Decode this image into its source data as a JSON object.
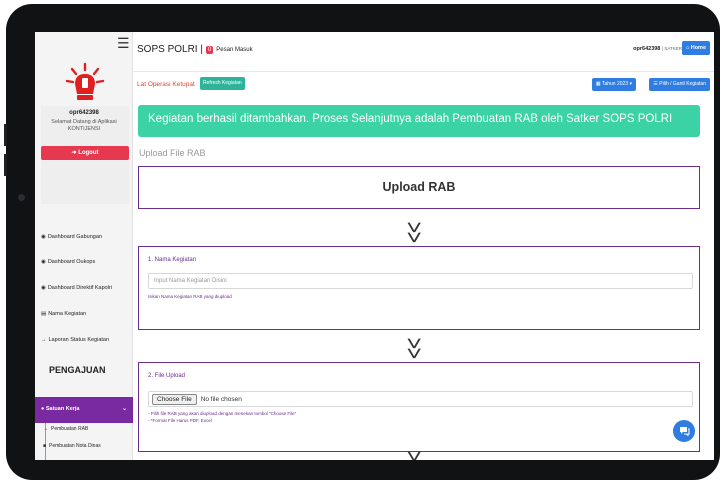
{
  "topbar": {
    "brand": "SOPS POLRI |",
    "pesan_count": "0",
    "pesan_label": "Pesan Masuk",
    "user": "opr642398",
    "user_role": "| SATKER",
    "home_label": "Home"
  },
  "sidebar": {
    "user_id": "opr642398",
    "welcome_line1": "Selamat Datang di Aplikasi",
    "welcome_line2": "KONTIJENSI",
    "logout_label": "Logout",
    "items": [
      {
        "label": "Dashboard Gabungan",
        "icon": "dashboard-icon"
      },
      {
        "label": "Dashboard Oukops",
        "icon": "dashboard-icon"
      },
      {
        "label": "Dashboard Direktif Kapolri",
        "icon": "dashboard-icon"
      },
      {
        "label": "Nama Kegiatan",
        "icon": "list-icon"
      },
      {
        "label": "Laporan Status Kegiatan",
        "icon": "arrow-right-icon"
      }
    ],
    "section_label": "PENGAJUAN",
    "satker_label": "Satuan Kerja",
    "sub_items": [
      {
        "label": "Pembuatan RAB",
        "icon": "arrow-right-icon"
      },
      {
        "label": "Pembuatan Nota Dinas",
        "icon": "lock-icon"
      }
    ]
  },
  "toolbar": {
    "lat_operasi": "Lat Operasi Ketupat",
    "refresh_label": "Refresh Kegiatan",
    "tahun_label": "Tahun 2023",
    "pilih_label": "Pilih / Ganti Kegiatan"
  },
  "main": {
    "alert": "Kegiatan berhasil ditambahkan. Proses Selanjutnya adalah Pembuatan RAB oleh Satker SOPS POLRI",
    "section_title": "Upload File RAB",
    "upload_heading": "Upload RAB",
    "step1": {
      "title": "1. Nama Kegiatan",
      "placeholder": "Input Nama Kegiatan Disini",
      "hint": "Isikan Nama Kegiatan RAB yang diupload"
    },
    "step2": {
      "title": "2. File Upload",
      "choose_label": "Choose File",
      "file_status": "No file chosen",
      "hint1": "- Pilih file RAB yang akan diupload dengan menekan tombol \"Choose File\"",
      "hint2": "- *Format File Harus PDF, Excel"
    }
  },
  "colors": {
    "accent_purple": "#6b2d8e",
    "alert_green": "#3bd3a6",
    "primary_blue": "#2f7de1",
    "danger_red": "#e63950"
  }
}
